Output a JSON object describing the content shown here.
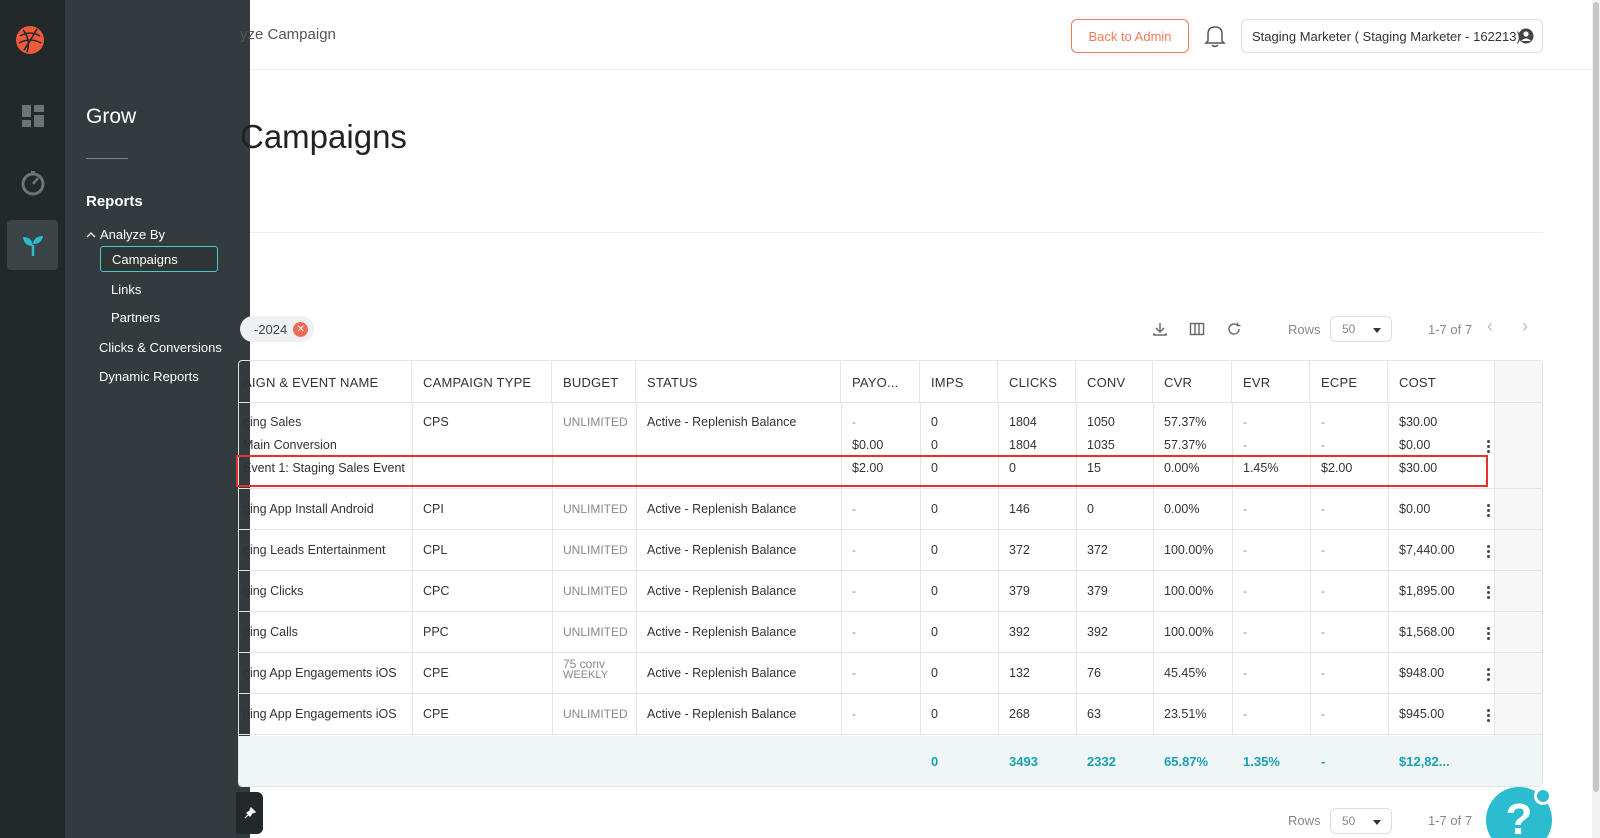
{
  "sidebar": {
    "section_title": "Grow",
    "reports_label": "Reports",
    "analyze_by_label": "Analyze By",
    "analyze_items": [
      {
        "label": "Campaigns",
        "active": true
      },
      {
        "label": "Links",
        "active": false
      },
      {
        "label": "Partners",
        "active": false
      }
    ],
    "other_items": [
      {
        "label": "Clicks & Conversions"
      },
      {
        "label": "Dynamic Reports"
      }
    ]
  },
  "header": {
    "breadcrumb": "yze Campaign",
    "back_to_admin_label": "Back to Admin",
    "user_label": "Staging Marketer ( Staging Marketer - 162213)"
  },
  "page": {
    "title": "Campaigns"
  },
  "toolbar": {
    "filter_chip": "-2024",
    "rows_label": "Rows",
    "rows_value": "50",
    "pager_text": "1-7 of 7"
  },
  "table": {
    "columns": [
      "AIGN & EVENT NAME",
      "CAMPAIGN TYPE",
      "BUDGET",
      "STATUS",
      "PAYO...",
      "IMPS",
      "CLICKS",
      "CONV",
      "CVR",
      "EVR",
      "ECPE",
      "COST"
    ],
    "groups": [
      {
        "lines": [
          {
            "name": "ging Sales",
            "type": "CPS",
            "budget": "UNLIMITED",
            "status": "Active - Replenish Balance",
            "payout": "-",
            "imps": "0",
            "clicks": "1804",
            "conv": "1050",
            "cvr": "57.37%",
            "evr": "-",
            "ecpe": "-",
            "cost": "$30.00"
          },
          {
            "name": "Main Conversion",
            "type": "",
            "budget": "",
            "status": "",
            "payout": "$0.00",
            "imps": "0",
            "clicks": "1804",
            "conv": "1035",
            "cvr": "57.37%",
            "evr": "-",
            "ecpe": "-",
            "cost": "$0.00"
          },
          {
            "name": "Event 1: Staging Sales Event",
            "type": "",
            "budget": "",
            "status": "",
            "payout": "$2.00",
            "imps": "0",
            "clicks": "0",
            "conv": "15",
            "cvr": "0.00%",
            "evr": "1.45%",
            "ecpe": "$2.00",
            "cost": "$30.00"
          }
        ]
      },
      {
        "lines": [
          {
            "name": "ging App Install Android",
            "type": "CPI",
            "budget": "UNLIMITED",
            "status": "Active - Replenish Balance",
            "payout": "-",
            "imps": "0",
            "clicks": "146",
            "conv": "0",
            "cvr": "0.00%",
            "evr": "-",
            "ecpe": "-",
            "cost": "$0.00"
          }
        ]
      },
      {
        "lines": [
          {
            "name": "ging Leads Entertainment",
            "type": "CPL",
            "budget": "UNLIMITED",
            "status": "Active - Replenish Balance",
            "payout": "-",
            "imps": "0",
            "clicks": "372",
            "conv": "372",
            "cvr": "100.00%",
            "evr": "-",
            "ecpe": "-",
            "cost": "$7,440.00"
          }
        ]
      },
      {
        "lines": [
          {
            "name": "ging Clicks",
            "type": "CPC",
            "budget": "UNLIMITED",
            "status": "Active - Replenish Balance",
            "payout": "-",
            "imps": "0",
            "clicks": "379",
            "conv": "379",
            "cvr": "100.00%",
            "evr": "-",
            "ecpe": "-",
            "cost": "$1,895.00"
          }
        ]
      },
      {
        "lines": [
          {
            "name": "ging Calls",
            "type": "PPC",
            "budget": "UNLIMITED",
            "status": "Active - Replenish Balance",
            "payout": "-",
            "imps": "0",
            "clicks": "392",
            "conv": "392",
            "cvr": "100.00%",
            "evr": "-",
            "ecpe": "-",
            "cost": "$1,568.00"
          }
        ]
      },
      {
        "lines": [
          {
            "name": "ging App Engagements iOS",
            "type": "CPE",
            "budget": "75 conv",
            "budget2": "WEEKLY",
            "status": "Active - Replenish Balance",
            "payout": "-",
            "imps": "0",
            "clicks": "132",
            "conv": "76",
            "cvr": "45.45%",
            "evr": "-",
            "ecpe": "-",
            "cost": "$948.00"
          }
        ]
      },
      {
        "lines": [
          {
            "name": "ging App Engagements iOS",
            "type": "CPE",
            "budget": "UNLIMITED",
            "status": "Active - Replenish Balance",
            "payout": "-",
            "imps": "0",
            "clicks": "268",
            "conv": "63",
            "cvr": "23.51%",
            "evr": "-",
            "ecpe": "-",
            "cost": "$945.00"
          }
        ]
      }
    ],
    "totals": {
      "imps": "0",
      "clicks": "3493",
      "conv": "2332",
      "cvr": "65.87%",
      "evr": "1.35%",
      "ecpe": "-",
      "cost": "$12,82..."
    }
  },
  "bottom_toolbar": {
    "rows_label": "Rows",
    "rows_value": "50",
    "pager_text": "1-7 of 7"
  },
  "help_label": "?",
  "colors": {
    "accent": "#1aa0b4",
    "admin_button": "#ef7a5a",
    "highlight": "#e5322d",
    "sidebar_bg": "#323b3e",
    "rail_bg": "#23292b"
  },
  "icons": [
    "logo-icon",
    "dashboard-icon",
    "gauge-icon",
    "sprout-icon",
    "bell-icon",
    "user-circle-icon",
    "download-icon",
    "columns-icon",
    "refresh-icon",
    "pin-icon",
    "help-icon"
  ]
}
